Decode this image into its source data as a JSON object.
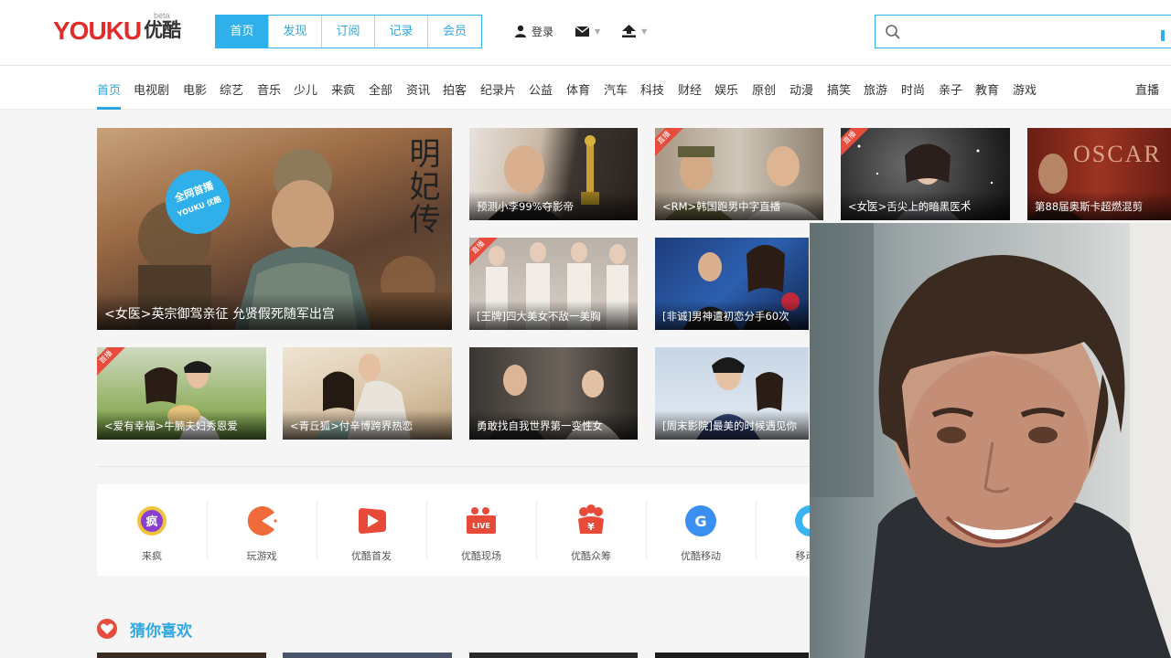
{
  "logo": {
    "text": "YOUKU",
    "cn": "优酷",
    "beta": "beta"
  },
  "main_tabs": [
    "首页",
    "发现",
    "订阅",
    "记录",
    "会员"
  ],
  "header_tools": {
    "login": "登录"
  },
  "search": {
    "placeholder": ""
  },
  "nav": {
    "items": [
      "首页",
      "电视剧",
      "电影",
      "综艺",
      "音乐",
      "少儿",
      "来疯",
      "全部",
      "资讯",
      "拍客",
      "纪录片",
      "公益",
      "体育",
      "汽车",
      "科技",
      "财经",
      "娱乐",
      "原创",
      "动漫",
      "搞笑",
      "旅游",
      "时尚",
      "亲子",
      "教育",
      "游戏"
    ],
    "live": "直播"
  },
  "tiles": {
    "hero": {
      "caption": "<女医>英宗御驾亲征 允贤假死随军出宫",
      "stamp_line1": "全网首播",
      "stamp_line2": "YOUKU 优酷",
      "calligraphy": "明妃传"
    },
    "t1": {
      "caption": "预测小李99%夺影帝"
    },
    "t2": {
      "caption": "<RM>韩国跑男中字直播",
      "badge": "直播"
    },
    "t3": {
      "caption": "<女医>舌尖上的暗黑医术",
      "badge": "直播"
    },
    "t4": {
      "caption": "第88届奥斯卡超燃混剪",
      "overlay": "OSCAR"
    },
    "t5": {
      "caption": "[王牌]四大美女不敌一美胸",
      "badge": "直播"
    },
    "t6": {
      "caption": "[非诚]男神遭初恋分手60次"
    },
    "t7": {
      "caption": "<爱有幸福>牛腩夫妇秀恩爱",
      "badge": "首播"
    },
    "t8": {
      "caption": "<青丘狐>付辛博跨界热恋"
    },
    "t9": {
      "caption": "勇敢找自我世界第一变性女"
    },
    "t10": {
      "caption": "[周末影院]最美的时候遇见你"
    }
  },
  "strip": [
    "来疯",
    "玩游戏",
    "优酷首发",
    "优酷现场",
    "优酷众筹",
    "优酷移动",
    "移动有"
  ],
  "strip_icon_texts": {
    "laifeng": "疯",
    "live": "LIVE",
    "crowdfund": "¥",
    "mobile": "G"
  },
  "guess": {
    "title": "猜你喜欢"
  },
  "colors": {
    "accent": "#2fb0ea",
    "red": "#e74c3c",
    "logo_red": "#e12c2c"
  }
}
